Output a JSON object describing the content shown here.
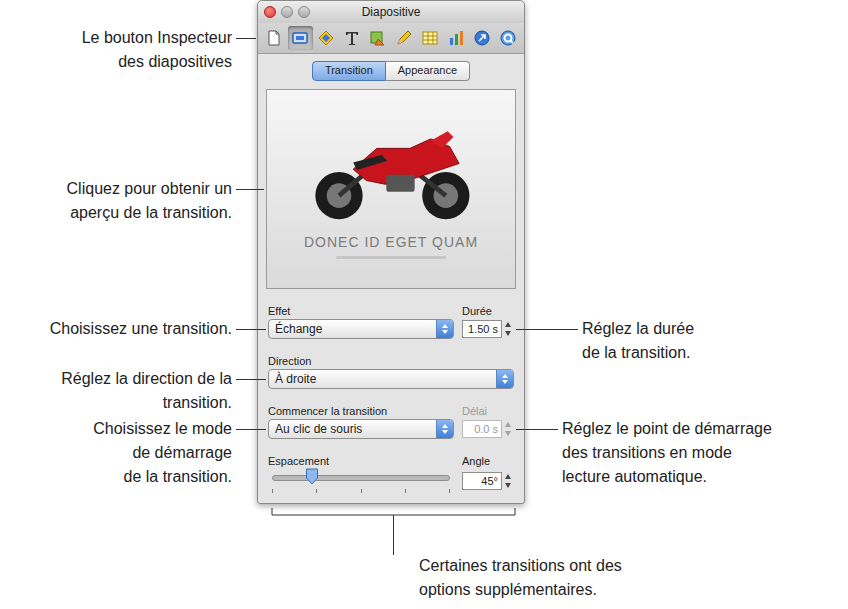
{
  "window": {
    "title": "Diapositive"
  },
  "toolbar": [
    {
      "kind": "document",
      "selected": false
    },
    {
      "kind": "slide",
      "selected": true
    },
    {
      "kind": "build",
      "selected": false
    },
    {
      "kind": "text",
      "selected": false
    },
    {
      "kind": "graphic",
      "selected": false
    },
    {
      "kind": "metrics",
      "selected": false
    },
    {
      "kind": "table",
      "selected": false
    },
    {
      "kind": "chart",
      "selected": false
    },
    {
      "kind": "hyperlink",
      "selected": false
    },
    {
      "kind": "quicktime",
      "selected": false
    }
  ],
  "tabs": [
    {
      "label": "Transition",
      "selected": true
    },
    {
      "label": "Appearance",
      "selected": false
    }
  ],
  "preview": {
    "title": "DONEC ID EGET QUAM"
  },
  "effect": {
    "label": "Effet",
    "value": "Échange"
  },
  "duration": {
    "label": "Durée",
    "value": "1.50 s"
  },
  "direction": {
    "label": "Direction",
    "value": "À droite"
  },
  "start": {
    "label": "Commencer la transition",
    "value": "Au clic de souris"
  },
  "delay": {
    "label": "Délai",
    "value": "0.0 s",
    "disabled": true
  },
  "spacing": {
    "label": "Espacement",
    "level": 0.22
  },
  "angle": {
    "label": "Angle",
    "value": "45°"
  },
  "callouts": [
    {
      "lines": [
        "Le bouton Inspecteur",
        "des diapositives"
      ]
    },
    {
      "lines": [
        "Cliquez pour obtenir un",
        "aperçu de la transition."
      ]
    },
    {
      "lines": [
        "Choisissez une transition."
      ]
    },
    {
      "lines": [
        "Réglez la direction de la",
        "transition."
      ]
    },
    {
      "lines": [
        "Choisissez le mode",
        "de démarrage",
        "de la transition."
      ]
    },
    {
      "lines": [
        "Réglez la durée",
        "de la transition."
      ]
    },
    {
      "lines": [
        "Réglez le point de démarrage",
        "des transitions en mode",
        "lecture automatique."
      ]
    }
  ],
  "note": {
    "lines": [
      "Certaines transitions ont des",
      "options supplémentaires."
    ]
  }
}
